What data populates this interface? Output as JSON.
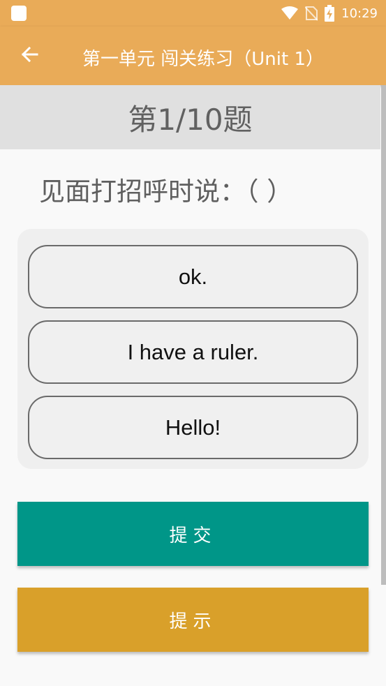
{
  "status_bar": {
    "time": "10:29",
    "icons": [
      "app-notification-icon",
      "wifi-icon",
      "no-sim-icon",
      "battery-charging-icon"
    ]
  },
  "app_bar": {
    "back_icon": "arrow-back-icon",
    "title": "第一单元 闯关练习（Unit 1）"
  },
  "quiz": {
    "counter": "第1/10题",
    "question": "见面打招呼时说：（ ）",
    "options": [
      {
        "label": "ok."
      },
      {
        "label": "I have a ruler."
      },
      {
        "label": "Hello!"
      }
    ]
  },
  "actions": {
    "submit_label": "提交",
    "hint_label": "提示"
  },
  "colors": {
    "app_bar": "#e9ab58",
    "submit": "#009688",
    "hint": "#d9a02a",
    "counter_band": "#e0e0e0"
  }
}
